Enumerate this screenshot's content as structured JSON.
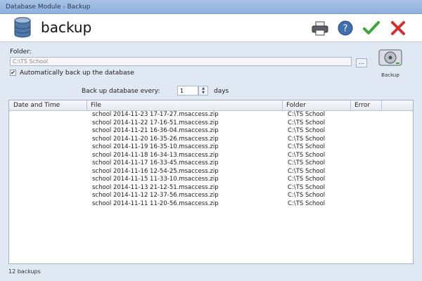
{
  "window": {
    "title": "Database Module - Backup"
  },
  "header": {
    "heading": "backup",
    "buttons": [
      "printer-icon",
      "help-icon",
      "ok-check-icon",
      "close-x-icon"
    ]
  },
  "settings": {
    "folder_label": "Folder:",
    "folder_value": "C:\\TS School",
    "browse_label": "...",
    "auto_backup_label": "Automatically back up the database",
    "auto_backup_checked": true,
    "backup_button_label": "Backup"
  },
  "schedule": {
    "label": "Back up database every:",
    "value": "1",
    "unit": "days"
  },
  "table": {
    "columns": [
      "Date and Time",
      "File",
      "Folder",
      "Error"
    ],
    "rows": [
      {
        "file": "school 2014-11-23 17-17-27.msaccess.zip",
        "folder": "C:\\TS School"
      },
      {
        "file": "school 2014-11-22 17-16-51.msaccess.zip",
        "folder": "C:\\TS School"
      },
      {
        "file": "school 2014-11-21 16-36-04.msaccess.zip",
        "folder": "C:\\TS School"
      },
      {
        "file": "school 2014-11-20 16-35-26.msaccess.zip",
        "folder": "C:\\TS School"
      },
      {
        "file": "school 2014-11-19 16-35-10.msaccess.zip",
        "folder": "C:\\TS School"
      },
      {
        "file": "school 2014-11-18 16-34-13.msaccess.zip",
        "folder": "C:\\TS School"
      },
      {
        "file": "school 2014-11-17 16-33-45.msaccess.zip",
        "folder": "C:\\TS School"
      },
      {
        "file": "school 2014-11-16 12-54-25.msaccess.zip",
        "folder": "C:\\TS School"
      },
      {
        "file": "school 2014-11-15 11-33-10.msaccess.zip",
        "folder": "C:\\TS School"
      },
      {
        "file": "school 2014-11-13 21-12-51.msaccess.zip",
        "folder": "C:\\TS School"
      },
      {
        "file": "school 2014-11-12 12-37-56.msaccess.zip",
        "folder": "C:\\TS School"
      },
      {
        "file": "school 2014-11-11 11-20-56.msaccess.zip",
        "folder": "C:\\TS School"
      }
    ]
  },
  "status": {
    "text": "12 backups"
  },
  "colors": {
    "title_bar": "#9cb9df",
    "background": "#dfe8f3",
    "help_blue": "#3f6fb0",
    "ok_green": "#3aa83a",
    "close_red": "#d03030"
  }
}
